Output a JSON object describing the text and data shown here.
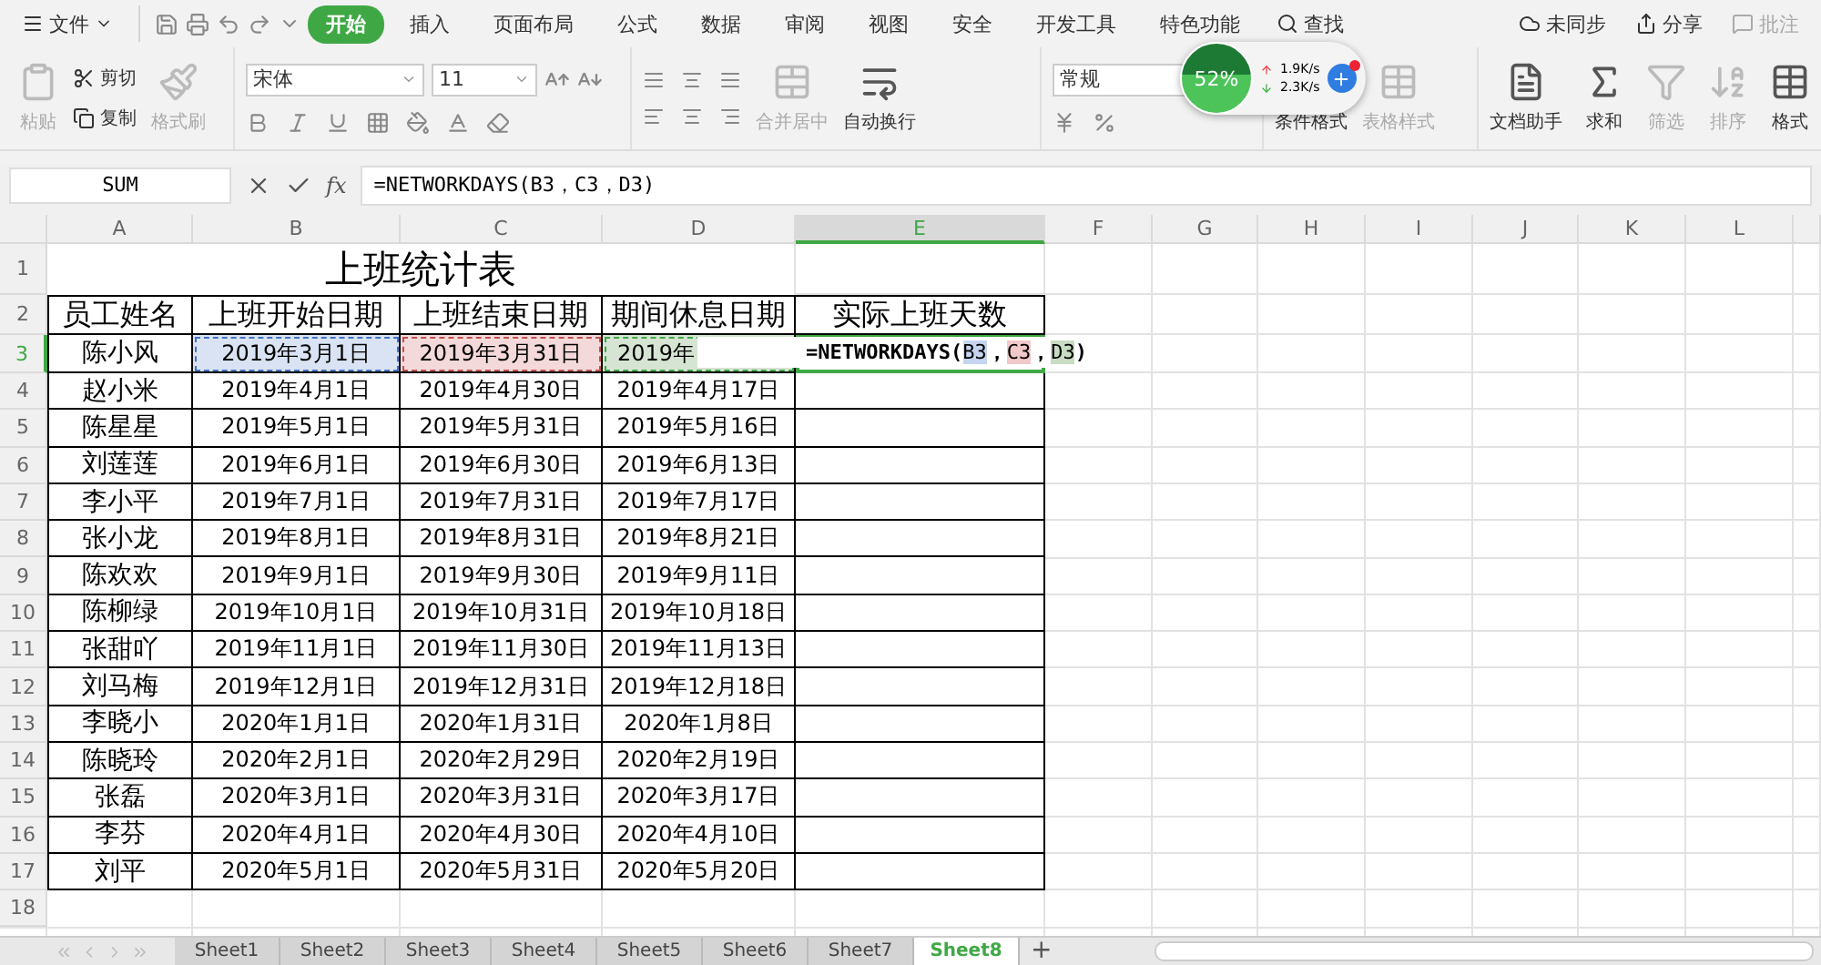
{
  "menu": {
    "file": "文件",
    "tabs": [
      {
        "label": "开始",
        "selected": true
      },
      {
        "label": "插入",
        "selected": false
      },
      {
        "label": "页面布局",
        "selected": false
      },
      {
        "label": "公式",
        "selected": false
      },
      {
        "label": "数据",
        "selected": false
      },
      {
        "label": "审阅",
        "selected": false
      },
      {
        "label": "视图",
        "selected": false
      },
      {
        "label": "安全",
        "selected": false
      },
      {
        "label": "开发工具",
        "selected": false
      },
      {
        "label": "特色功能",
        "selected": false
      }
    ],
    "search": "查找",
    "right": [
      {
        "label": "未同步",
        "disabled": false
      },
      {
        "label": "分享",
        "disabled": false
      },
      {
        "label": "批注",
        "disabled": true
      }
    ]
  },
  "ribbon": {
    "clipboard": {
      "paste": {
        "label": "粘贴",
        "disabled": true
      },
      "cut": {
        "label": "剪切",
        "disabled": false
      },
      "copy": {
        "label": "复制",
        "disabled": false
      },
      "format_painter": {
        "label": "格式刷",
        "disabled": true
      }
    },
    "font": {
      "family": "宋体",
      "size": "11"
    },
    "alignment": {
      "merge": {
        "label": "合并居中",
        "disabled": true
      },
      "wrap": {
        "label": "自动换行",
        "disabled": false
      }
    },
    "number": {
      "format": "常规"
    },
    "styles": {
      "conditional": {
        "label": "条件格式",
        "disabled": false
      },
      "table_style": {
        "label": "表格样式",
        "disabled": true
      }
    },
    "tools": [
      {
        "label": "文档助手",
        "disabled": false
      },
      {
        "label": "求和",
        "disabled": false
      },
      {
        "label": "筛选",
        "disabled": true
      },
      {
        "label": "排序",
        "disabled": true
      },
      {
        "label": "格式",
        "disabled": false
      }
    ]
  },
  "speed_widget": {
    "percent": "52%",
    "up": "1.9K/s",
    "down": "2.3K/s"
  },
  "formula_bar": {
    "name_box": "SUM",
    "fx": "fx",
    "formula": "=NETWORKDAYS(B3，C3，D3)"
  },
  "sheet": {
    "columns": [
      {
        "label": "A",
        "selected": false
      },
      {
        "label": "B",
        "selected": false
      },
      {
        "label": "C",
        "selected": false
      },
      {
        "label": "D",
        "selected": false
      },
      {
        "label": "E",
        "selected": true
      },
      {
        "label": "F",
        "selected": false
      },
      {
        "label": "G",
        "selected": false
      },
      {
        "label": "H",
        "selected": false
      },
      {
        "label": "I",
        "selected": false
      },
      {
        "label": "J",
        "selected": false
      },
      {
        "label": "K",
        "selected": false
      },
      {
        "label": "L",
        "selected": false
      }
    ],
    "title": {
      "number": "1",
      "text": "上班统计表"
    },
    "header": {
      "number": "2",
      "cells": [
        "员工姓名",
        "上班开始日期",
        "上班结束日期",
        "期间休息日期",
        "实际上班天数"
      ]
    },
    "rows": [
      {
        "number": "3",
        "selected": true,
        "cells": [
          {
            "text": "陈小风"
          },
          {
            "text": "2019年3月1日",
            "color": "#dae3f3"
          },
          {
            "text": "2019年3月31日",
            "color": "#f4d9da"
          },
          {
            "text": "2019年",
            "color": "#d6e4d3"
          }
        ],
        "editor": [
          {
            "kind": "text",
            "text": "=NETWORKDAYS("
          },
          {
            "kind": "ref",
            "text": "B3",
            "color": "#c5d5f0"
          },
          {
            "kind": "text",
            "text": "，"
          },
          {
            "kind": "ref",
            "text": "C3",
            "color": "#f1c9cb"
          },
          {
            "kind": "text",
            "text": "，"
          },
          {
            "kind": "ref",
            "text": "D3",
            "color": "#c8dcc4"
          },
          {
            "kind": "text",
            "text": ")"
          }
        ]
      },
      {
        "number": "4",
        "selected": false,
        "cells": [
          {
            "text": "赵小米"
          },
          {
            "text": "2019年4月1日"
          },
          {
            "text": "2019年4月30日"
          },
          {
            "text": "2019年4月17日"
          }
        ]
      },
      {
        "number": "5",
        "selected": false,
        "cells": [
          {
            "text": "陈星星"
          },
          {
            "text": "2019年5月1日"
          },
          {
            "text": "2019年5月31日"
          },
          {
            "text": "2019年5月16日"
          }
        ]
      },
      {
        "number": "6",
        "selected": false,
        "cells": [
          {
            "text": "刘莲莲"
          },
          {
            "text": "2019年6月1日"
          },
          {
            "text": "2019年6月30日"
          },
          {
            "text": "2019年6月13日"
          }
        ]
      },
      {
        "number": "7",
        "selected": false,
        "cells": [
          {
            "text": "李小平"
          },
          {
            "text": "2019年7月1日"
          },
          {
            "text": "2019年7月31日"
          },
          {
            "text": "2019年7月17日"
          }
        ]
      },
      {
        "number": "8",
        "selected": false,
        "cells": [
          {
            "text": "张小龙"
          },
          {
            "text": "2019年8月1日"
          },
          {
            "text": "2019年8月31日"
          },
          {
            "text": "2019年8月21日"
          }
        ]
      },
      {
        "number": "9",
        "selected": false,
        "cells": [
          {
            "text": "陈欢欢"
          },
          {
            "text": "2019年9月1日"
          },
          {
            "text": "2019年9月30日"
          },
          {
            "text": "2019年9月11日"
          }
        ]
      },
      {
        "number": "10",
        "selected": false,
        "cells": [
          {
            "text": "陈柳绿"
          },
          {
            "text": "2019年10月1日"
          },
          {
            "text": "2019年10月31日"
          },
          {
            "text": "2019年10月18日"
          }
        ]
      },
      {
        "number": "11",
        "selected": false,
        "cells": [
          {
            "text": "张甜吖"
          },
          {
            "text": "2019年11月1日"
          },
          {
            "text": "2019年11月30日"
          },
          {
            "text": "2019年11月13日"
          }
        ]
      },
      {
        "number": "12",
        "selected": false,
        "cells": [
          {
            "text": "刘马梅"
          },
          {
            "text": "2019年12月1日"
          },
          {
            "text": "2019年12月31日"
          },
          {
            "text": "2019年12月18日"
          }
        ]
      },
      {
        "number": "13",
        "selected": false,
        "cells": [
          {
            "text": "李晓小"
          },
          {
            "text": "2020年1月1日"
          },
          {
            "text": "2020年1月31日"
          },
          {
            "text": "2020年1月8日"
          }
        ]
      },
      {
        "number": "14",
        "selected": false,
        "cells": [
          {
            "text": "陈晓玲"
          },
          {
            "text": "2020年2月1日"
          },
          {
            "text": "2020年2月29日"
          },
          {
            "text": "2020年2月19日"
          }
        ]
      },
      {
        "number": "15",
        "selected": false,
        "cells": [
          {
            "text": "张磊"
          },
          {
            "text": "2020年3月1日"
          },
          {
            "text": "2020年3月31日"
          },
          {
            "text": "2020年3月17日"
          }
        ]
      },
      {
        "number": "16",
        "selected": false,
        "cells": [
          {
            "text": "李芬"
          },
          {
            "text": "2020年4月1日"
          },
          {
            "text": "2020年4月30日"
          },
          {
            "text": "2020年4月10日"
          }
        ]
      },
      {
        "number": "17",
        "selected": false,
        "cells": [
          {
            "text": "刘平"
          },
          {
            "text": "2020年5月1日"
          },
          {
            "text": "2020年5月31日"
          },
          {
            "text": "2020年5月20日"
          }
        ]
      }
    ],
    "empty_rows": [
      "18"
    ]
  },
  "sheet_tabs": [
    {
      "label": "Sheet1",
      "selected": false
    },
    {
      "label": "Sheet2",
      "selected": false
    },
    {
      "label": "Sheet3",
      "selected": false
    },
    {
      "label": "Sheet4",
      "selected": false
    },
    {
      "label": "Sheet5",
      "selected": false
    },
    {
      "label": "Sheet6",
      "selected": false
    },
    {
      "label": "Sheet7",
      "selected": false
    },
    {
      "label": "Sheet8",
      "selected": true
    }
  ],
  "add_sheet": "+"
}
